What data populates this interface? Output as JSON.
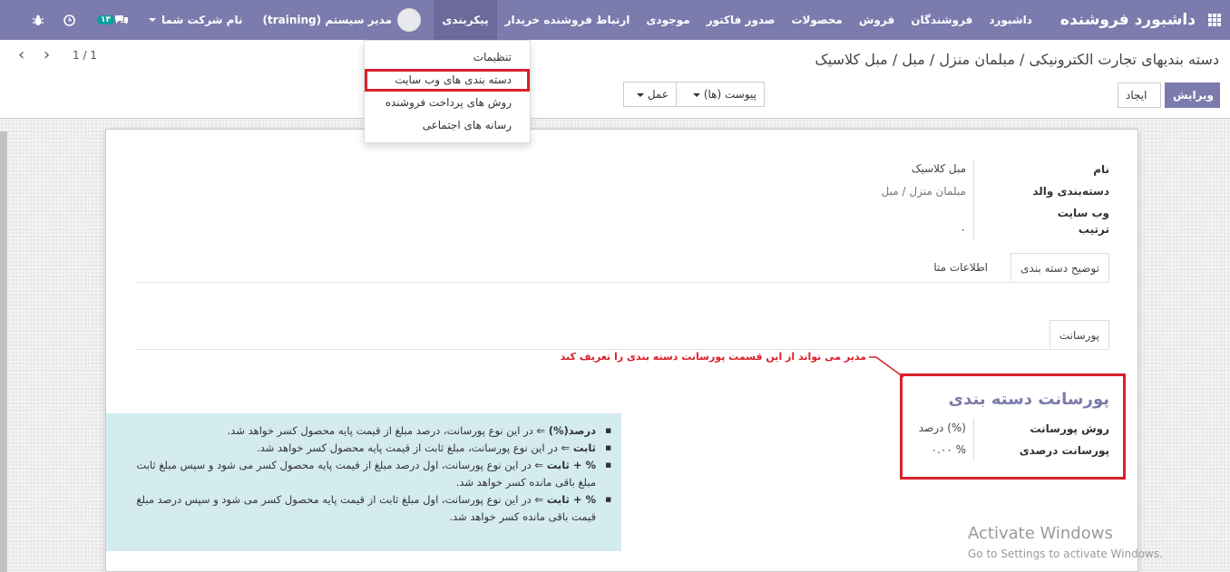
{
  "navbar": {
    "brand": "داشبورد فروشنده",
    "menu": [
      "داشبورد",
      "فروشندگان",
      "فروش",
      "محصولات",
      "صدور فاکتور",
      "موجودی",
      "ارتباط فروشنده خریدار",
      "پیکربندی"
    ],
    "active_index": 7,
    "badge": "۱۳",
    "company": "نام شرکت شما",
    "user": "مدیر سیستم (training)"
  },
  "dropdown": {
    "items": [
      "تنظیمات",
      "دسته بندی های وب سایت",
      "روش های پرداخت فروشنده",
      "رسانه های اجتماعی"
    ],
    "highlighted_index": 1
  },
  "breadcrumb": "دسته بندیهای تجارت الکترونیکی / مبلمان منزل / مبل / مبل کلاسیک",
  "toolbar": {
    "edit": "ویرایش",
    "create": "ایجاد",
    "attachments": "پیوست (ها)",
    "action": "عمل",
    "pager": "1 / 1"
  },
  "form": {
    "name_label": "نام",
    "name_value": "مبل کلاسیک",
    "parent_label": "دسته‌بندی والد",
    "parent_value": "مبلمان منزل / مبل",
    "website_label": "وب سایت",
    "sequence_label": "ترتیب",
    "sequence_value": "۰"
  },
  "tabs": [
    "توضیح دسته بندی",
    "اطلاعات متا"
  ],
  "tabs2": [
    "پورسانت"
  ],
  "note": "مدیر می تواند از این قسمت پورسانت دسته بندی را تعریف کند",
  "commission": {
    "title": "پورسانت دسته بندی",
    "method_label": "روش پورسانت",
    "method_value": "درصد (%)",
    "percent_label": "پورسانت درصدی",
    "percent_value": "۰.۰۰ %"
  },
  "info": {
    "items": [
      {
        "key": "درصد(%)",
        "text": " ⇐ در این نوع پورسانت، درصد مبلغ از قیمت پایه محصول کسر خواهد شد.",
        "cont": ""
      },
      {
        "key": "ثابت",
        "text": " ⇐ در این نوع پورسانت، مبلغ ثابت از قیمت پایه محصول کسر خواهد شد.",
        "cont": ""
      },
      {
        "key": "% + ثابت",
        "text": " ⇐ در این نوع پورسانت، اول درصد مبلغ از قیمت پایه محصول کسر می شود و سپس مبلغ ثابت",
        "cont": "مبلغ باقی مانده کسر خواهد شد."
      },
      {
        "key": "% + ثابت",
        "text": " ⇐ در این نوع پورسانت، اول مبلغ ثابت از قیمت پایه محصول کسر می شود و سپس درصد مبلغ",
        "cont": "قیمت باقی مانده کسر خواهد شد."
      }
    ]
  },
  "watermark": {
    "line1": "Activate Windows",
    "line2": "Go to Settings to activate Windows."
  }
}
